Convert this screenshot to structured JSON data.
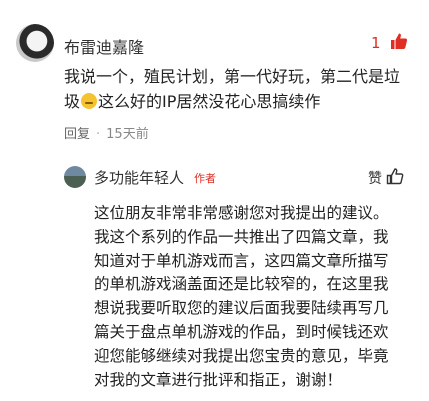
{
  "comment": {
    "user_name": "布雷迪嘉隆",
    "like_count": "1",
    "text_line1": "我说一个，殖民计划，第一代好玩，第二代是垃",
    "text_line2_pre": "圾",
    "text_line2_post": "这么好的IP居然没花心思搞续作",
    "reply_label": "回复",
    "time": "15天前"
  },
  "reply": {
    "user_name": "多功能年轻人",
    "author_tag": "作者",
    "like_label": "赞",
    "lines": [
      "这位朋友非常非常感谢您对我提出的建议。",
      "我这个系列的作品一共推出了四篇文章，我",
      "知道对于单机游戏而言，这四篇文章所描写",
      "的单机游戏涵盖面还是比较窄的，在这里我",
      "想说我要听取您的建议后面我要陆续再写几",
      "篇关于盘点单机游戏的作品，到时候钱还欢",
      "迎您能够继续对我提出您宝贵的意见，毕竟",
      "对我的文章进行批评和指正，谢谢！"
    ]
  },
  "colors": {
    "accent_red": "#e02e24",
    "meta_gray": "#888888"
  }
}
